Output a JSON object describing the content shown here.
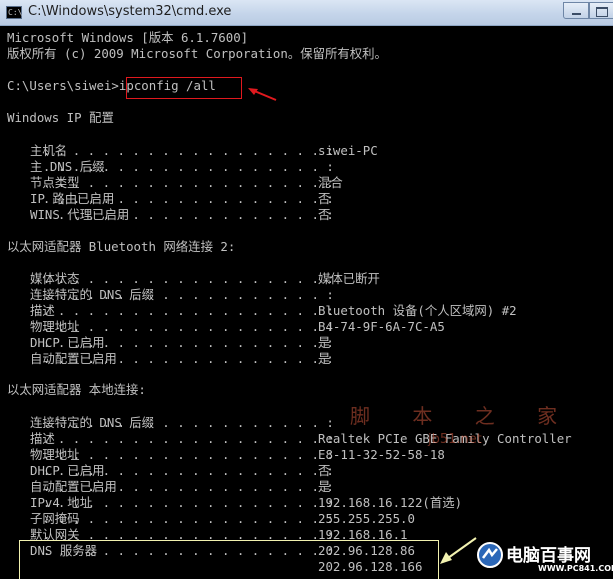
{
  "window": {
    "title": "C:\\Windows\\system32\\cmd.exe",
    "icon_text": "C:\\"
  },
  "console": {
    "header_line1": "Microsoft Windows [版本 6.1.7600]",
    "header_line2": "版权所有 (c) 2009 Microsoft Corporation。保留所有权利。",
    "prompt": "C:\\Users\\siwei>",
    "command": "ipconfig /all",
    "windows_ip_header": "Windows IP 配置",
    "host_name_label": "主机名",
    "host_name_value": "siwei-PC",
    "primary_dns_suffix_label": "主 DNS 后缀",
    "primary_dns_suffix_value": "",
    "node_type_label": "节点类型",
    "node_type_value": "混合",
    "ip_routing_label": "IP 路由已启用",
    "ip_routing_value": "否",
    "wins_proxy_label": "WINS 代理已启用",
    "wins_proxy_value": "否",
    "bt_adapter_header": "以太网适配器 Bluetooth 网络连接 2:",
    "bt_media_state_label": "媒体状态",
    "bt_media_state_value": "媒体已断开",
    "bt_conn_dns_suffix_label": "连接特定的 DNS 后缀",
    "bt_conn_dns_suffix_value": "",
    "bt_description_label": "描述",
    "bt_description_value": "Bluetooth 设备(个人区域网) #2",
    "bt_physical_label": "物理地址",
    "bt_physical_value": "B4-74-9F-6A-7C-A5",
    "bt_dhcp_label": "DHCP 已启用",
    "bt_dhcp_value": "是",
    "bt_autoconfig_label": "自动配置已启用",
    "bt_autoconfig_value": "是",
    "lan_adapter_header": "以太网适配器 本地连接:",
    "lan_conn_dns_suffix_label": "连接特定的 DNS 后缀",
    "lan_conn_dns_suffix_value": "",
    "lan_description_label": "描述",
    "lan_description_value": "Realtek PCIe GBE Family Controller",
    "lan_physical_label": "物理地址",
    "lan_physical_value": "E8-11-32-52-58-18",
    "lan_dhcp_label": "DHCP 已启用",
    "lan_dhcp_value": "否",
    "lan_autoconfig_label": "自动配置已启用",
    "lan_autoconfig_value": "是",
    "lan_ipv4_label": "IPv4 地址",
    "lan_ipv4_value": "192.168.16.122(首选)",
    "lan_subnet_label": "子网掩码",
    "lan_subnet_value": "255.255.255.0",
    "lan_gateway_label": "默认网关",
    "lan_gateway_value": "192.168.16.1",
    "lan_dns_label": "DNS 服务器",
    "lan_dns_value1": "202.96.128.86",
    "lan_dns_value2": "202.96.128.166"
  },
  "watermark": {
    "top": "脚 本 之 家",
    "bottom": "jb51.net"
  },
  "brand": {
    "name": "电脑百事网",
    "url": "WWW.PC841.COM"
  },
  "colors": {
    "console_bg": "#000000",
    "console_text": "#c0c0c0",
    "highlight_red": "#e0191e",
    "highlight_yellow": "#f2f2b0"
  }
}
